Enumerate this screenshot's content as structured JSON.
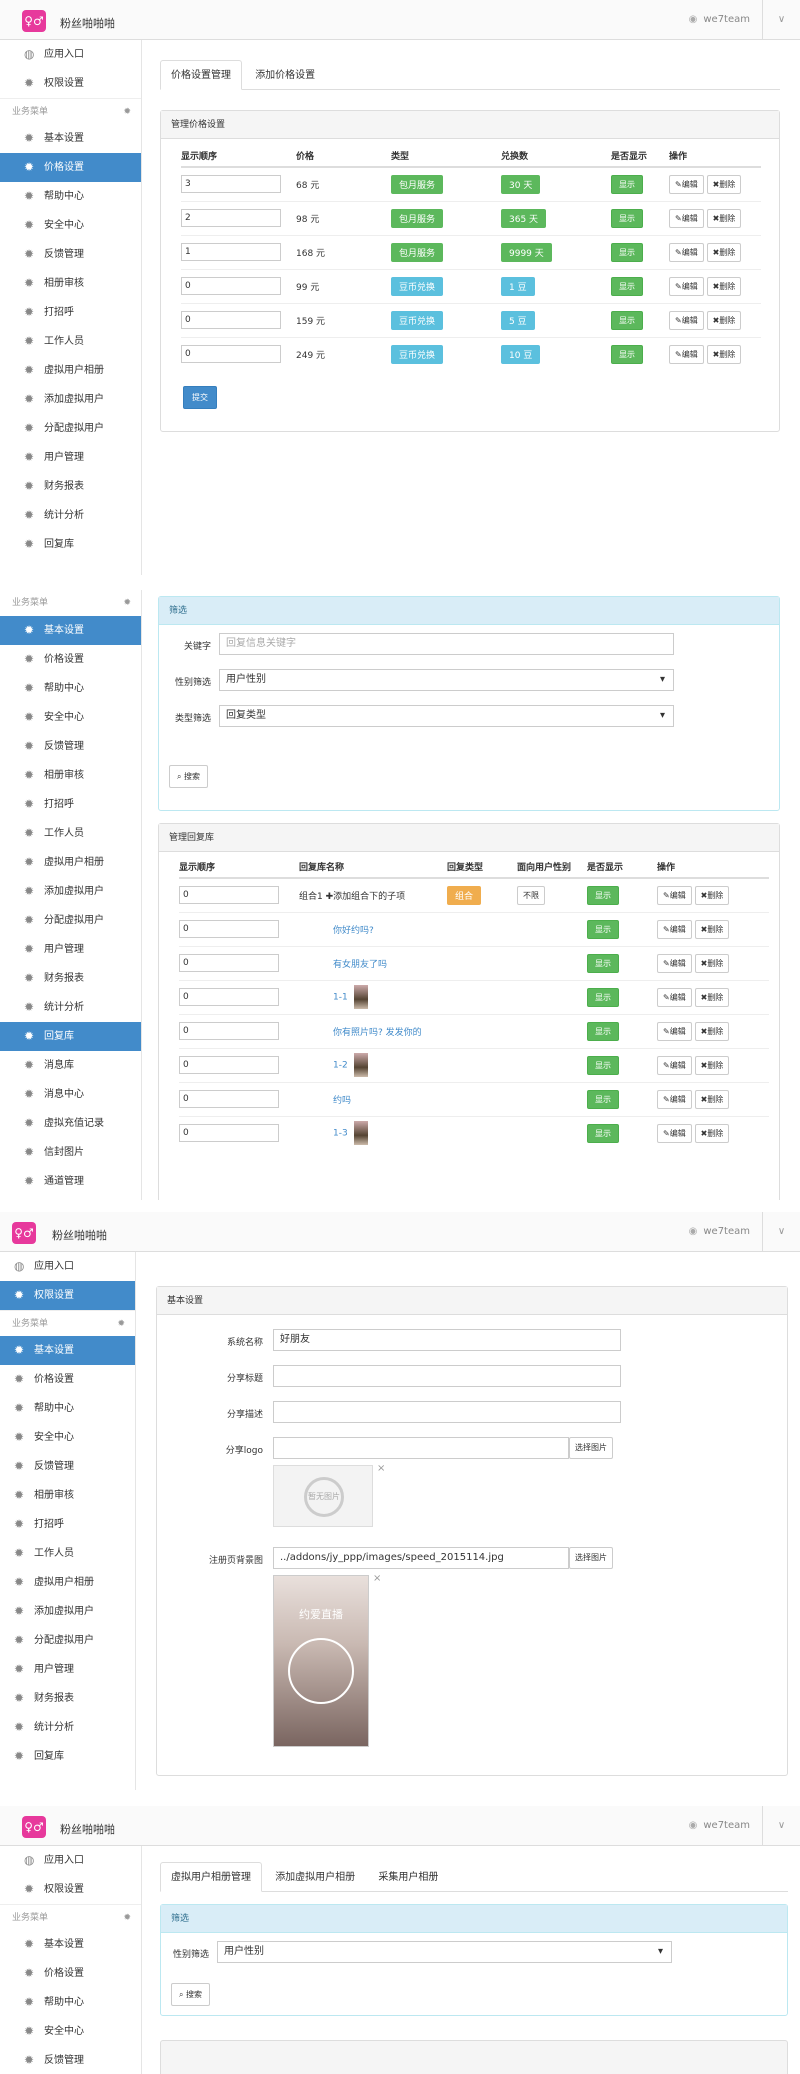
{
  "app": {
    "brand": "粉丝啪啪啪",
    "user": "we7team"
  },
  "sidebar": {
    "entry": "应用入口",
    "perm": "权限设置",
    "section": "业务菜单",
    "items": [
      "基本设置",
      "价格设置",
      "帮助中心",
      "安全中心",
      "反馈管理",
      "相册审核",
      "打招呼",
      "工作人员",
      "虚拟用户相册",
      "添加虚拟用户",
      "分配虚拟用户",
      "用户管理",
      "财务报表",
      "统计分析",
      "回复库",
      "消息库",
      "消息中心",
      "虚拟充值记录",
      "信封图片",
      "通道管理"
    ]
  },
  "s1": {
    "tabs": [
      "价格设置管理",
      "添加价格设置"
    ],
    "panel_title": "管理价格设置",
    "headers": [
      "显示顺序",
      "价格",
      "类型",
      "兑换数",
      "是否显示",
      "操作"
    ],
    "rows": [
      {
        "order": "3",
        "price": "68 元",
        "type": "包月服务",
        "amount": "30 天"
      },
      {
        "order": "2",
        "price": "98 元",
        "type": "包月服务",
        "amount": "365 天"
      },
      {
        "order": "1",
        "price": "168 元",
        "type": "包月服务",
        "amount": "9999 天"
      },
      {
        "order": "0",
        "price": "99 元",
        "type": "豆币兑换",
        "amount": "1 豆"
      },
      {
        "order": "0",
        "price": "159 元",
        "type": "豆币兑换",
        "amount": "5 豆"
      },
      {
        "order": "0",
        "price": "249 元",
        "type": "豆币兑换",
        "amount": "10 豆"
      }
    ],
    "show": "显示",
    "edit": "编辑",
    "del": "删除",
    "submit": "提交"
  },
  "s2": {
    "filter_title": "筛选",
    "kw_label": "关键字",
    "kw_ph": "回复信息关键字",
    "sex_label": "性别筛选",
    "sex_val": "用户性别",
    "type_label": "类型筛选",
    "type_val": "回复类型",
    "search": "搜索",
    "panel_title": "管理回复库",
    "headers": [
      "显示顺序",
      "回复库名称",
      "回复类型",
      "面向用户性别",
      "是否显示",
      "操作"
    ],
    "row0": {
      "order": "0",
      "name": "组合1",
      "add": "添加组合下的子项",
      "type": "组合",
      "sex": "不限"
    },
    "rows": [
      {
        "order": "0",
        "name": "你好约吗?"
      },
      {
        "order": "0",
        "name": "有女朋友了吗"
      },
      {
        "order": "0",
        "name": "1-1"
      },
      {
        "order": "0",
        "name": "你有照片吗? 发发你的"
      },
      {
        "order": "0",
        "name": "1-2"
      },
      {
        "order": "0",
        "name": "约吗"
      },
      {
        "order": "0",
        "name": "1-3"
      }
    ]
  },
  "s3": {
    "panel_title": "基本设置",
    "name_label": "系统名称",
    "name_val": "好朋友",
    "share_title": "分享标题",
    "share_desc": "分享描述",
    "logo_label": "分享logo",
    "choose": "选择图片",
    "noimg": "暂无图片",
    "bg_label": "注册页背景图",
    "bg_val": "../addons/jy_ppp/images/speed_2015114.jpg",
    "poster": "约爱直播"
  },
  "s4": {
    "tabs": [
      "虚拟用户相册管理",
      "添加虚拟用户相册",
      "采集用户相册"
    ],
    "filter_title": "筛选",
    "sex_label": "性别筛选",
    "sex_val": "用户性别",
    "search": "搜索"
  }
}
